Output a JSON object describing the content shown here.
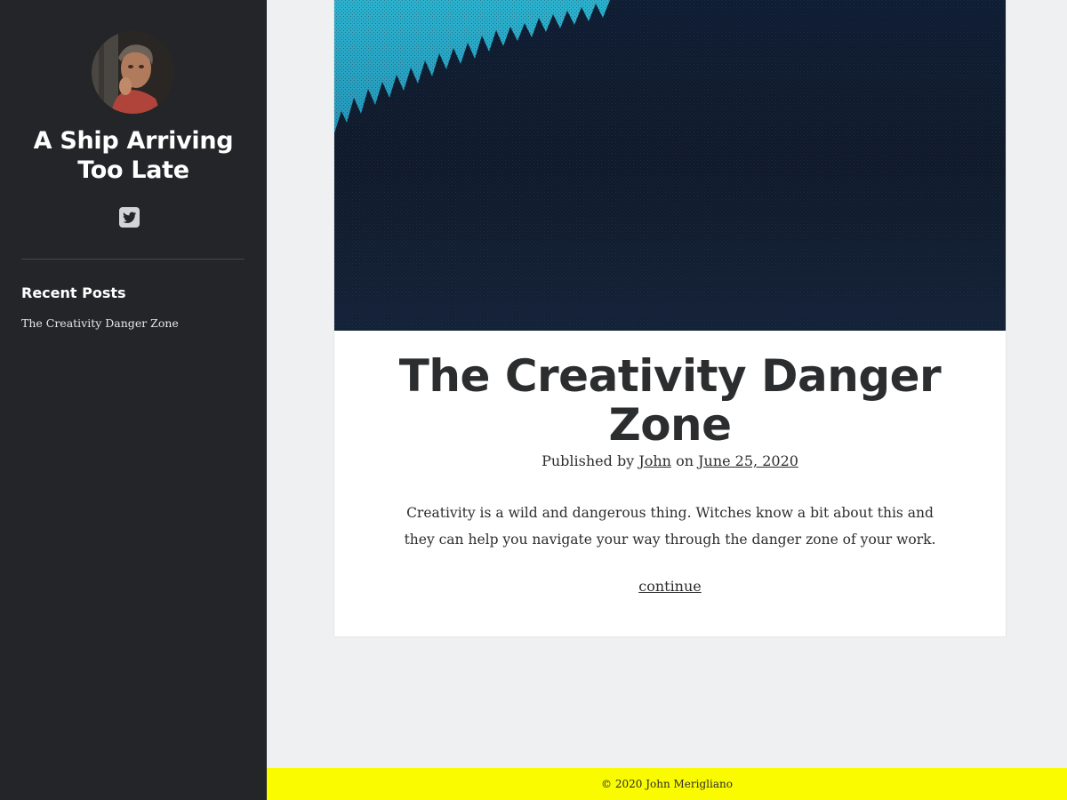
{
  "sidebar": {
    "site_title": "A Ship Arriving Too Late",
    "social": [
      {
        "icon": "twitter-icon"
      }
    ],
    "widget": {
      "title": "Recent Posts",
      "items": [
        "The Creativity Danger Zone"
      ]
    }
  },
  "post": {
    "title": "The Creativity Danger Zone",
    "meta": {
      "prefix": "Published by",
      "author": "John",
      "connector": "on",
      "date": "June 25, 2020"
    },
    "excerpt": "Creativity is a wild and dangerous thing. Witches know a bit about this and they can help you navigate your way through the danger zone of your work.",
    "continue_label": "continue"
  },
  "footer": {
    "copyright": "© 2020 John Merigliano"
  },
  "colors": {
    "sidebar_bg": "#232528",
    "page_bg": "#eff0f1",
    "footer_bg": "#fbfb00",
    "text": "#2b2d2f"
  }
}
